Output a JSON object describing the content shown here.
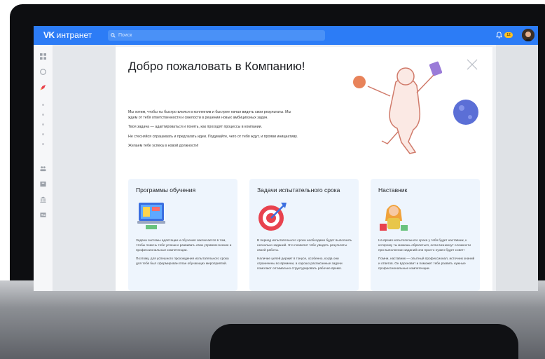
{
  "header": {
    "logo_mark": "VK",
    "logo_text": "интранет",
    "search_placeholder": "Поиск",
    "notification_count": "12"
  },
  "modal": {
    "title": "Добро пожаловать в Компанию!",
    "intro": [
      "Мы хотим, чтобы ты быстро влился в коллектив и быстрее начал видеть свои результаты. Мы ждем от тебя ответственности и смелости в решении новых амбициозных задач.",
      "Твоя задача — адаптироваться и понять, как проходят процессы в компании.",
      "Не стесняйся спрашивать и предлагать идеи. Подумайте, чего от тебя ждут, и прояви инициативу.",
      "Желаем тебе успеха в новой должности!"
    ],
    "cards": [
      {
        "title": "Программы обучения",
        "icon": "laptop-icon",
        "paragraphs": [
          "Задача системы адаптации и обучения заключается в том, чтобы помочь тебе успешно развивать свои управленческие и профессиональные компетенции.",
          "Поэтому, для успешного прохождения испытательного срока для тебя был сформирован план обучающих мероприятий."
        ]
      },
      {
        "title": "Задачи испытательного срока",
        "icon": "target-icon",
        "paragraphs": [
          "В период испытательного срока необходимо будет выполнить несколько заданий. Это позволит тебе увидеть результаты своей работы.",
          "Наличие целей держит в тонусе, особенно, когда они ограничены во времени, а хорошо расписанные задачи помогают оптимально структурировать рабочее время."
        ]
      },
      {
        "title": "Наставник",
        "icon": "mentor-icon",
        "paragraphs": [
          "На время испытательного срока у тебя будет наставник, к которому ты можешь обратиться, если возникнут сложности при выполнении заданий или просто нужен будет совет!",
          "Помни, наставник — опытный профессионал, источник знаний и ответов. Он вдохновит и поможет тебе развить нужные профессиональные компетенции."
        ]
      }
    ]
  },
  "colors": {
    "brand": "#2c7cf6",
    "card_bg": "#eef5fd",
    "badge": "#ffc224"
  }
}
